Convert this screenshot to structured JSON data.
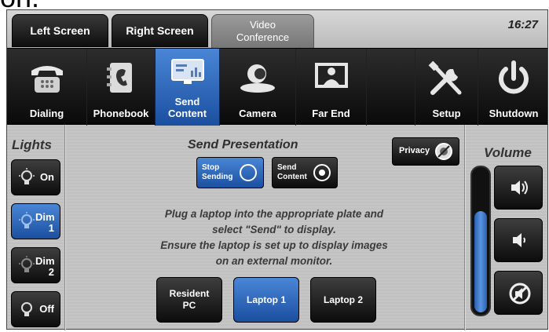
{
  "clipped_text": "on.",
  "tabs": [
    {
      "label": "Left Screen"
    },
    {
      "label": "Right Screen"
    },
    {
      "label": "Video Conference"
    }
  ],
  "clock": "16:27",
  "nav": [
    {
      "label": "Dialing",
      "icon": "phone-icon"
    },
    {
      "label": "Phonebook",
      "icon": "phonebook-icon"
    },
    {
      "label": "Send Content",
      "icon": "send-content-icon",
      "active": true
    },
    {
      "label": "Camera",
      "icon": "camera-icon"
    },
    {
      "label": "Far End",
      "icon": "far-end-icon"
    },
    {
      "label": "",
      "icon": ""
    },
    {
      "label": "Setup",
      "icon": "setup-tools-icon"
    },
    {
      "label": "Shutdown",
      "icon": "power-icon"
    }
  ],
  "lights": {
    "title": "Lights",
    "buttons": [
      {
        "label": "On"
      },
      {
        "label": "Dim 1",
        "active": true
      },
      {
        "label": "Dim 2"
      },
      {
        "label": "Off"
      }
    ]
  },
  "presentation": {
    "title": "Send Presentation",
    "stop_label": "Stop Sending",
    "send_label": "Send Content",
    "privacy_label": "Privacy",
    "instructions": [
      "Plug a laptop into the appropriate plate and",
      "select \"Send\" to display.",
      "Ensure the laptop is set up to display images",
      "on an external monitor."
    ],
    "sources": [
      {
        "label": "Resident PC",
        "active": false
      },
      {
        "label": "Laptop 1",
        "active": true
      },
      {
        "label": "Laptop 2",
        "active": false
      }
    ]
  },
  "volume": {
    "title": "Volume",
    "level": 0.72,
    "up_icon": "volume-up-icon",
    "down_icon": "volume-down-icon",
    "mute_icon": "mute-icon"
  },
  "colors": {
    "accent": "#1b4fa0",
    "button_dark": "#0c0c0c"
  }
}
